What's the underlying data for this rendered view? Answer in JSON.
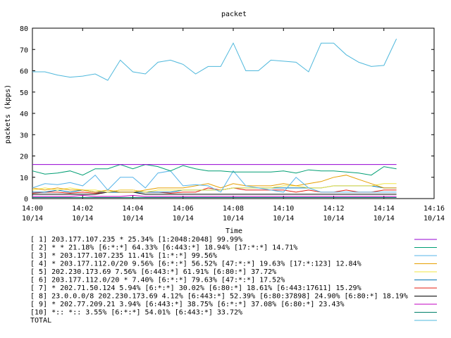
{
  "chart_data": {
    "type": "line",
    "title": "packet",
    "xlabel": "Time",
    "ylabel": "packets (kpps)",
    "ylim": [
      0,
      80
    ],
    "yticks": [
      "0",
      "10",
      "20",
      "30",
      "40",
      "50",
      "60",
      "70",
      "80"
    ],
    "xlim": [
      0,
      16
    ],
    "x_unit": "minutes after 14:00 on 10/14",
    "xticks": [
      {
        "time": "14:00",
        "date": "10/14"
      },
      {
        "time": "14:02",
        "date": "10/14"
      },
      {
        "time": "14:04",
        "date": "10/14"
      },
      {
        "time": "14:06",
        "date": "10/14"
      },
      {
        "time": "14:08",
        "date": "10/14"
      },
      {
        "time": "14:10",
        "date": "10/14"
      },
      {
        "time": "14:12",
        "date": "10/14"
      },
      {
        "time": "14:14",
        "date": "10/14"
      },
      {
        "time": "14:16",
        "date": "10/14"
      }
    ],
    "x": [
      0,
      0.5,
      1,
      1.5,
      2,
      2.5,
      3,
      3.5,
      4,
      4.5,
      5,
      5.5,
      6,
      6.5,
      7,
      7.5,
      8,
      8.5,
      9,
      9.5,
      10,
      10.5,
      11,
      11.5,
      12,
      12.5,
      13,
      13.5,
      14,
      14.5
    ],
    "grid": false,
    "legend_position": "bottom",
    "series": [
      {
        "name": "[ 1] 203.177.107.235 * 25.34%  [1:2048:2048] 99.99%",
        "color": "#9400d3",
        "values": [
          16,
          16,
          16,
          16,
          16,
          16,
          16,
          16,
          16,
          16,
          16,
          16,
          16,
          16,
          16,
          16,
          16,
          16,
          16,
          16,
          16,
          16,
          16,
          16,
          16,
          16,
          16,
          16,
          16,
          16
        ]
      },
      {
        "name": "[ 2] * * 21.18%  [6:*:*] 64.33% [6:443:*] 18.94% [17:*:*] 14.71%",
        "color": "#009e73",
        "values": [
          13,
          11.5,
          12,
          13,
          11,
          14,
          14,
          16,
          14,
          16,
          15,
          13,
          15.5,
          14,
          13,
          13,
          12.5,
          12.5,
          12.5,
          12.5,
          13,
          12,
          13.5,
          13,
          13,
          12.5,
          12,
          11,
          15,
          14
        ]
      },
      {
        "name": "[ 3] * 203.177.107.235 11.41%  [1:*:*] 99.56%",
        "color": "#56b4e9",
        "values": [
          5,
          7,
          6.5,
          7.5,
          6,
          11,
          4,
          10,
          10,
          5,
          12,
          13,
          6,
          6.5,
          6,
          3,
          13,
          6,
          5,
          4,
          3,
          10,
          5,
          3,
          3,
          3,
          3,
          3,
          3,
          3
        ]
      },
      {
        "name": "[ 4] * 203.177.112.0/20 9.56%  [6:*:*] 56.52% [47:*:*] 19.63% [17:*:123] 12.84%",
        "color": "#e69f00",
        "values": [
          5,
          4,
          5,
          4,
          4,
          3,
          4,
          3,
          3,
          4,
          5,
          5,
          5,
          6,
          7,
          5,
          7,
          6,
          6,
          6,
          7,
          6,
          7,
          8,
          10,
          11,
          9,
          7,
          5,
          5
        ]
      },
      {
        "name": "[ 5] 202.230.173.69 7.56%  [6:443:*] 61.91% [6:80:*] 37.72%",
        "color": "#f0e442",
        "values": [
          4,
          5,
          4,
          5,
          4,
          4,
          3,
          4,
          4,
          3,
          4,
          4,
          4,
          4,
          4,
          4,
          5,
          5,
          5,
          5,
          6,
          6,
          5,
          5,
          6,
          6,
          6,
          6,
          7,
          7
        ]
      },
      {
        "name": "[ 6] 203.177.112.0/20 * 7.40%  [6:*:*] 79.63% [47:*:*] 17.52%",
        "color": "#0072b2",
        "values": [
          3,
          3,
          4,
          3,
          4,
          3,
          3,
          3,
          3,
          3,
          3,
          3,
          4,
          4,
          4,
          4,
          5,
          5,
          5,
          5,
          5,
          5,
          5,
          5,
          6,
          6,
          6,
          6,
          5,
          5
        ]
      },
      {
        "name": "[ 7] * 202.71.50.124 5.94%  [6:*:*] 30.02% [6:80:*] 18.61% [6:443:17611] 15.29%",
        "color": "#e51e10",
        "values": [
          2.5,
          3,
          3,
          2.5,
          3,
          2.5,
          3,
          4,
          4,
          3,
          3,
          2.5,
          3,
          3,
          5,
          4,
          5,
          4,
          4,
          4,
          4,
          3,
          4,
          3,
          3,
          4,
          3,
          3,
          4,
          4
        ]
      },
      {
        "name": "[ 8] 23.0.0.0/8 202.230.173.69 4.12%  [6:443:*] 52.39% [6:80:37898] 24.90% [6:80:*] 18.19%",
        "color": "#000000",
        "values": [
          2,
          2,
          2,
          2,
          2,
          2,
          3,
          3,
          3,
          2,
          2,
          2,
          2,
          2,
          2,
          2,
          2,
          2,
          2,
          2,
          2,
          2,
          2,
          2,
          2,
          2,
          2,
          2,
          2,
          2
        ]
      },
      {
        "name": "[ 9] * 202.77.209.21 3.94%  [6:443:*] 38.75% [6:*:*] 37.08% [6:80:*] 23.43%",
        "color": "#c000c0",
        "values": [
          1,
          1,
          1,
          1,
          1.5,
          1,
          1,
          1,
          1.5,
          1,
          1,
          1,
          1,
          1,
          1,
          1,
          1,
          1,
          1,
          1,
          1,
          1,
          1,
          1,
          1,
          1,
          1,
          1,
          1,
          1
        ]
      },
      {
        "name": "[10] *:: *:: 3.55%  [6:*:*] 54.01% [6:443:*] 33.72%",
        "color": "#00806a",
        "values": [
          0.5,
          0.5,
          0.5,
          0.5,
          0.5,
          0.5,
          0.5,
          0.5,
          0.5,
          0.5,
          0.5,
          0.5,
          0.5,
          0.5,
          0.5,
          0.5,
          0.5,
          0.5,
          0.5,
          0.5,
          0.5,
          0.5,
          0.5,
          0.5,
          0.5,
          0.5,
          0.5,
          0.5,
          0.5,
          0.5
        ]
      },
      {
        "name": "TOTAL",
        "color": "#4fb8dc",
        "values": [
          59.5,
          59.5,
          58,
          57,
          57.5,
          58.5,
          55.5,
          65,
          59.5,
          58.5,
          64,
          65,
          63,
          58.5,
          62,
          62,
          73,
          60,
          60,
          65,
          64.5,
          64,
          59.5,
          73,
          73,
          67.5,
          64,
          62,
          62.5,
          75
        ]
      }
    ]
  }
}
